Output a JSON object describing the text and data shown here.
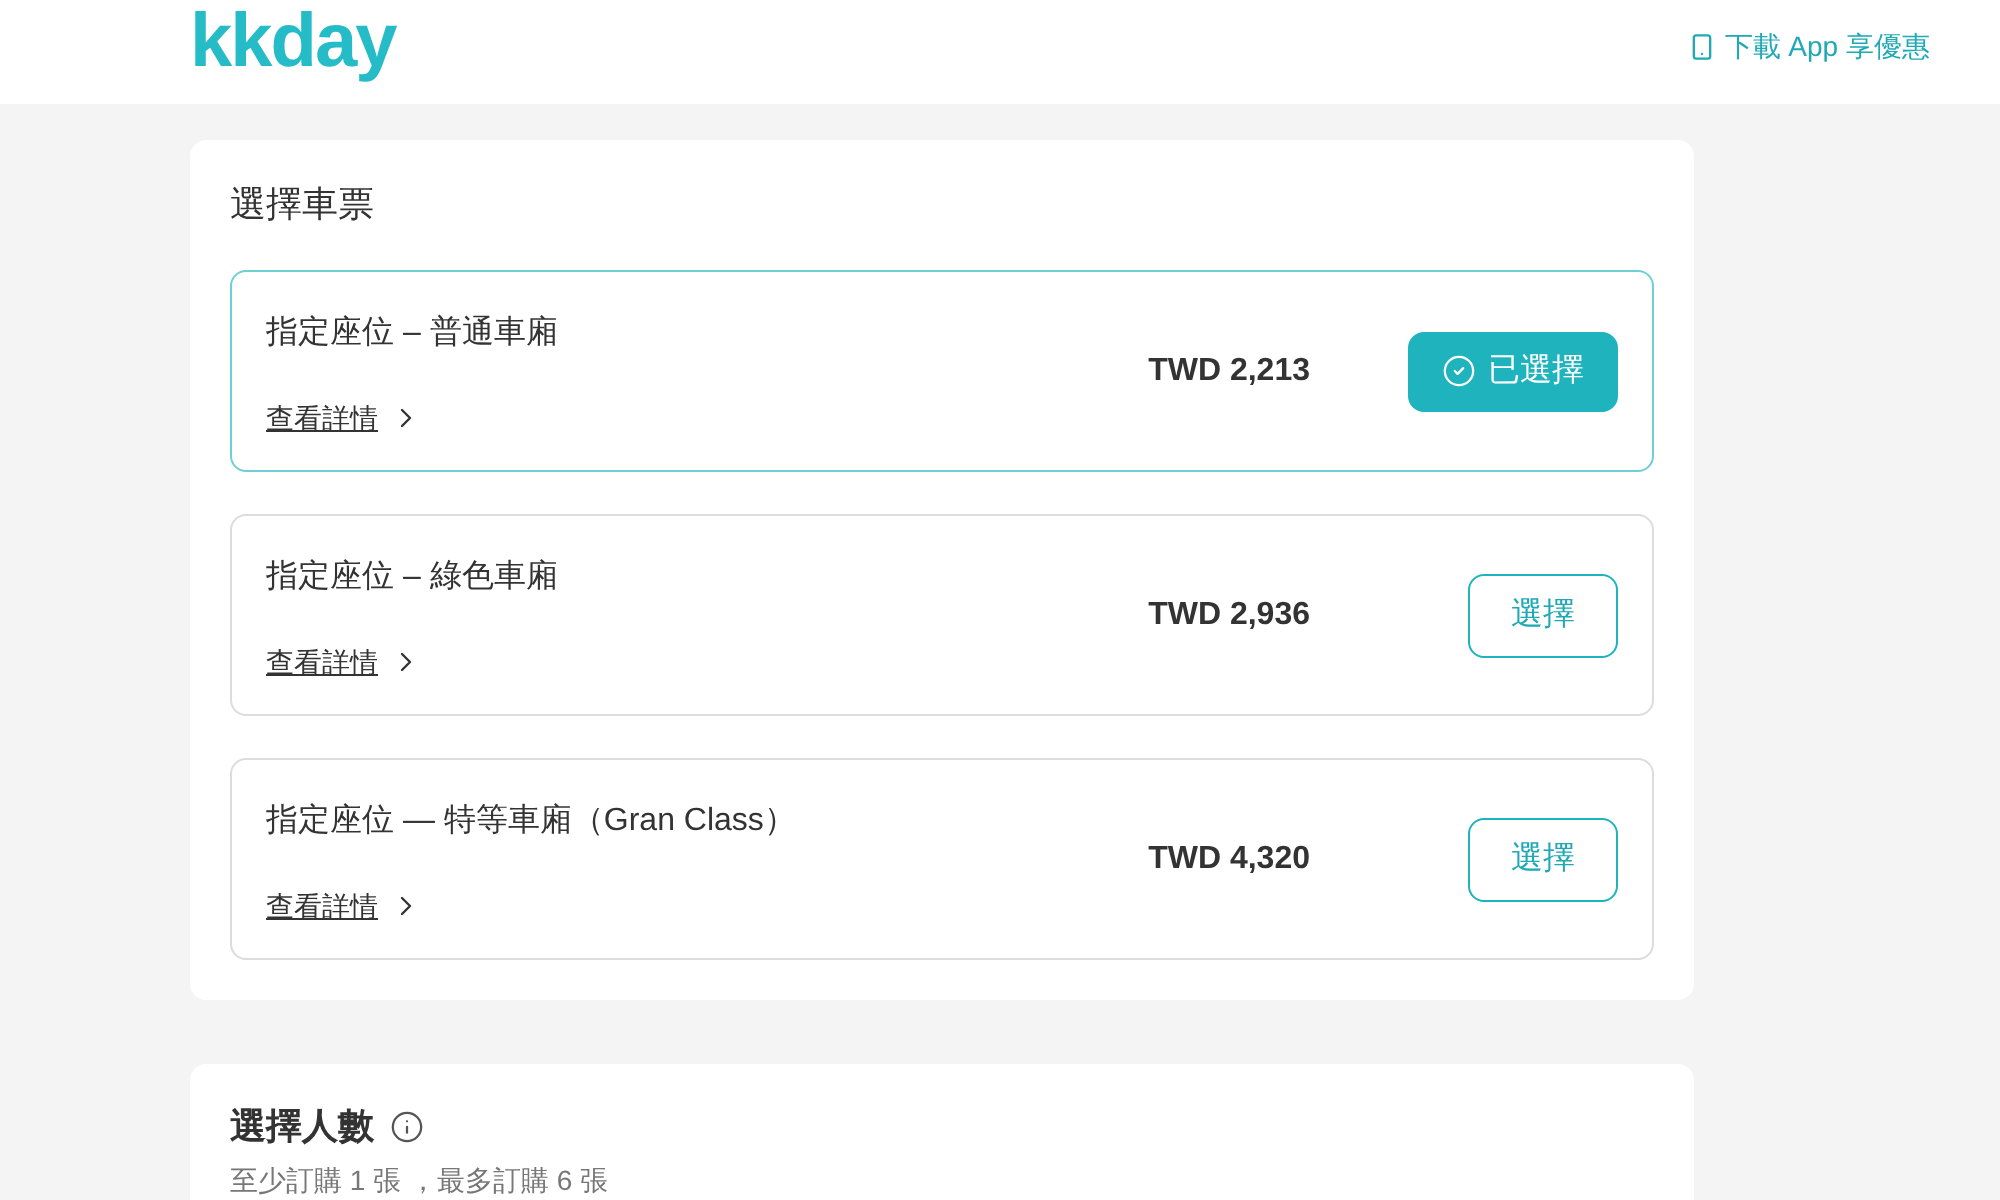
{
  "header": {
    "logo": "kkday",
    "app_promo": "下載 App 享優惠"
  },
  "ticket_section": {
    "title": "選擇車票",
    "tickets": [
      {
        "name": "指定座位 – 普通車廂",
        "details_link": "查看詳情",
        "price": "TWD 2,213",
        "button": "已選擇",
        "selected": true
      },
      {
        "name": "指定座位 – 綠色車廂",
        "details_link": "查看詳情",
        "price": "TWD 2,936",
        "button": "選擇",
        "selected": false
      },
      {
        "name": "指定座位 — 特等車廂（Gran Class）",
        "details_link": "查看詳情",
        "price": "TWD 4,320",
        "button": "選擇",
        "selected": false
      }
    ]
  },
  "quantity_section": {
    "title": "選擇人數",
    "note": "至少訂購 1 張 ，最多訂購 6 張"
  }
}
